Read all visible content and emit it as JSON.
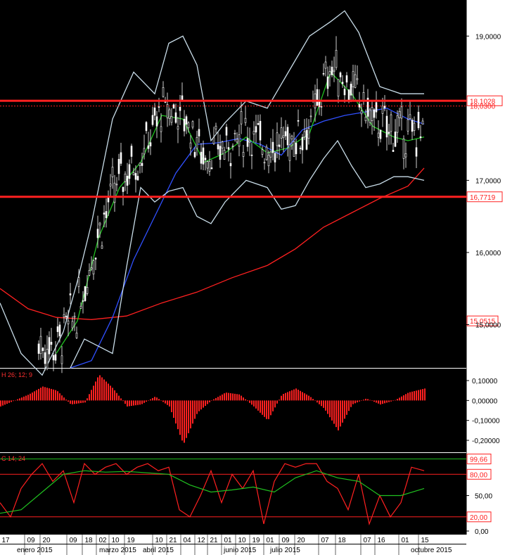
{
  "chart_data": [
    {
      "type": "candlestick",
      "panel": "price",
      "ylim": [
        14.4,
        19.5
      ],
      "yticks": [
        "19,0000",
        "17,0000",
        "16,0000",
        "15,0000"
      ],
      "ytick_values": [
        19.0,
        17.0,
        16.0,
        15.0
      ],
      "reference_lines": [
        {
          "label": "18,1028",
          "value": 18.1028,
          "color": "#ff2020"
        },
        {
          "label": "16,7719",
          "value": 16.7719,
          "color": "#ff2020"
        }
      ],
      "price_tags": [
        {
          "label": "15,0515",
          "value": 15.0515
        },
        {
          "label": "18,0300",
          "value": 18.03
        }
      ],
      "series": [
        {
          "color": "#ff2020",
          "x": [
            0,
            40,
            80,
            130,
            180,
            230,
            280,
            330,
            380,
            420,
            460,
            500,
            540,
            580,
            603
          ],
          "values": [
            15.5,
            15.22,
            15.1,
            15.07,
            15.12,
            15.3,
            15.45,
            15.65,
            15.82,
            16.05,
            16.35,
            16.55,
            16.75,
            16.92,
            17.17
          ]
        },
        {
          "color": "#3050ff",
          "x": [
            100,
            130,
            160,
            190,
            220,
            250,
            280,
            310,
            340,
            370,
            400,
            430,
            460,
            490,
            520,
            550,
            580,
            603
          ],
          "values": [
            14.4,
            14.5,
            15.1,
            15.9,
            16.5,
            17.1,
            17.5,
            17.52,
            17.58,
            17.5,
            17.35,
            17.7,
            17.82,
            17.9,
            17.95,
            18.0,
            17.85,
            17.78
          ]
        },
        {
          "color": "#20c020",
          "x": [
            80,
            110,
            140,
            170,
            200,
            230,
            260,
            290,
            320,
            350,
            380,
            410,
            440,
            470,
            500,
            530,
            560,
            580,
            603
          ],
          "values": [
            14.6,
            15.05,
            16.2,
            16.9,
            17.25,
            17.9,
            17.85,
            17.25,
            17.38,
            17.6,
            17.38,
            17.45,
            17.65,
            18.5,
            18.2,
            17.75,
            17.6,
            17.55,
            17.6
          ]
        },
        {
          "color": "#c8dce8",
          "x": [
            0,
            30,
            60,
            90,
            110,
            130,
            160,
            190,
            220,
            240,
            260,
            280,
            300,
            320,
            350,
            380,
            410,
            440,
            470,
            490,
            510,
            540,
            570,
            603
          ],
          "values": [
            15.3,
            14.6,
            14.3,
            14.9,
            15.6,
            16.4,
            17.85,
            18.5,
            18.2,
            18.9,
            19.0,
            18.6,
            17.55,
            17.8,
            18.1,
            18.0,
            18.5,
            19.0,
            19.2,
            19.35,
            19.05,
            18.3,
            18.2,
            18.2
          ]
        },
        {
          "color": "#c8dce8",
          "x": [
            100,
            120,
            140,
            160,
            180,
            200,
            220,
            240,
            260,
            280,
            300,
            320,
            350,
            380,
            400,
            420,
            440,
            460,
            480,
            500,
            520,
            540,
            560,
            580,
            603
          ],
          "values": [
            14.4,
            14.8,
            14.7,
            14.6,
            15.8,
            16.9,
            16.7,
            16.85,
            16.9,
            16.5,
            16.4,
            16.7,
            17.0,
            16.9,
            16.6,
            16.65,
            17.0,
            17.3,
            17.55,
            17.2,
            16.9,
            16.95,
            17.05,
            17.05,
            17.0
          ]
        }
      ]
    },
    {
      "type": "bar",
      "panel": "macd",
      "label": "H 26; 12; 9",
      "ylim": [
        -0.26,
        0.16
      ],
      "yticks": [
        "0,10000",
        "0,00000",
        "-0,10000",
        "-0,20000"
      ],
      "ytick_values": [
        0.1,
        0.0,
        -0.1,
        -0.2
      ],
      "color": "#ff2020",
      "series": [
        {
          "x": [
            0,
            20,
            40,
            60,
            80,
            100,
            120,
            140,
            160,
            180,
            200,
            220,
            240,
            260,
            280,
            300,
            320,
            340,
            360,
            380,
            400,
            420,
            440,
            460,
            480,
            500,
            520,
            540,
            560,
            580,
            603
          ],
          "values": [
            -0.03,
            0.0,
            0.03,
            0.07,
            0.05,
            -0.02,
            -0.01,
            0.13,
            0.06,
            -0.03,
            -0.02,
            0.02,
            -0.03,
            -0.22,
            -0.06,
            0.0,
            0.04,
            0.03,
            -0.03,
            -0.1,
            0.03,
            0.06,
            0.02,
            -0.04,
            -0.15,
            -0.02,
            0.01,
            -0.02,
            0.0,
            0.04,
            0.06
          ]
        }
      ]
    },
    {
      "type": "line",
      "panel": "stochastic",
      "label": "C 14; 24",
      "ylim": [
        -5,
        110
      ],
      "yticks": [
        "50,00",
        "0,00"
      ],
      "ytick_values": [
        50,
        0
      ],
      "reference_lines": [
        {
          "label": "80,00",
          "value": 80,
          "color": "#ff2020"
        },
        {
          "label": "20,00",
          "value": 20,
          "color": "#ff2020"
        }
      ],
      "price_tags": [
        {
          "label": "99,66",
          "value": 99.66,
          "color": "#20c020"
        }
      ],
      "series": [
        {
          "color": "#ff2020",
          "x": [
            0,
            15,
            30,
            45,
            60,
            75,
            90,
            105,
            120,
            135,
            150,
            165,
            180,
            195,
            210,
            225,
            240,
            255,
            270,
            285,
            300,
            315,
            330,
            345,
            360,
            375,
            390,
            405,
            420,
            435,
            450,
            465,
            480,
            495,
            510,
            525,
            540,
            555,
            570,
            585,
            603
          ],
          "values": [
            40,
            20,
            60,
            80,
            95,
            70,
            85,
            40,
            95,
            80,
            90,
            95,
            80,
            90,
            95,
            85,
            90,
            30,
            20,
            50,
            85,
            40,
            80,
            60,
            85,
            10,
            70,
            95,
            90,
            95,
            95,
            70,
            60,
            30,
            80,
            10,
            50,
            20,
            40,
            90,
            85
          ]
        },
        {
          "color": "#20c020",
          "x": [
            0,
            30,
            60,
            90,
            120,
            150,
            180,
            210,
            240,
            270,
            300,
            330,
            360,
            390,
            420,
            450,
            480,
            510,
            540,
            570,
            603
          ],
          "values": [
            25,
            30,
            55,
            80,
            85,
            83,
            84,
            82,
            80,
            65,
            55,
            58,
            62,
            55,
            75,
            85,
            75,
            70,
            50,
            50,
            60
          ]
        }
      ]
    }
  ],
  "xaxis": {
    "days": [
      "17",
      "09",
      "20",
      "09",
      "18",
      "02",
      "10",
      "19",
      "10",
      "21",
      "04",
      "12",
      "21",
      "01",
      "10",
      "19",
      "01",
      "09",
      "20",
      "07",
      "18",
      "07",
      "16",
      "01",
      "15"
    ],
    "months": [
      "enero 2015",
      "marzo 2015",
      "abril 2015",
      "junio 2015",
      "julio 2015",
      "octubre 2015"
    ]
  }
}
